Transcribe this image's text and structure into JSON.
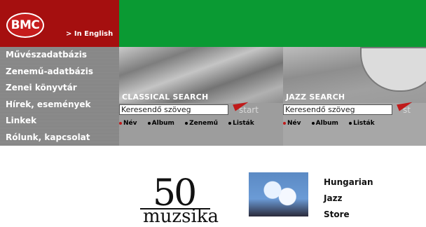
{
  "header": {
    "logo_text": "BMC",
    "english_link": "> In English",
    "brand_red": "#a50f0f",
    "brand_green": "#0a9a33"
  },
  "nav": {
    "items": [
      {
        "label": "Művészadatbázis"
      },
      {
        "label": "Zenemű-adatbázis"
      },
      {
        "label": "Zenei könyvtár"
      },
      {
        "label": "Hírek, események"
      },
      {
        "label": "Linkek"
      },
      {
        "label": "Rólunk, kapcsolat"
      }
    ]
  },
  "classical_search": {
    "title": "CLASSICAL SEARCH",
    "value": "Keresendő szöveg",
    "start_label": "start",
    "options": [
      "Név",
      "Album",
      "Zenemű",
      "Listák"
    ]
  },
  "jazz_search": {
    "title": "JAZZ SEARCH",
    "value": "Keresendő szöveg",
    "start_label": "st",
    "options": [
      "Név",
      "Album",
      "Listák"
    ]
  },
  "content": {
    "fifty_number": "50",
    "fifty_word": "muzsika",
    "store_lines": [
      "Hungarian",
      "Jazz",
      "Store"
    ]
  }
}
